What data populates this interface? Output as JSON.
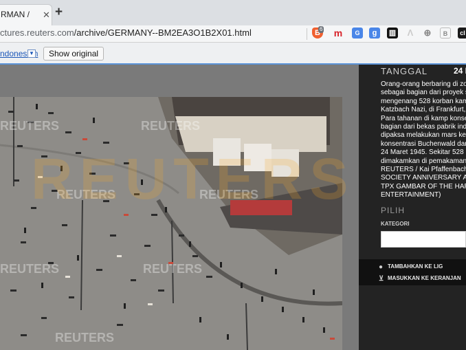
{
  "browser": {
    "tab_title": "RMAN /",
    "tab_close": "✕",
    "new_tab": "+",
    "url_host": "ctures.reuters.com",
    "url_path": "/archive/GERMANY--BM2EA3O1B2X01.html",
    "extensions": {
      "brave_badge": "6",
      "m": "m",
      "translate": "G",
      "google": "g",
      "bank": "▥",
      "a": "Λ",
      "globe": "⊕",
      "b": "B",
      "cl": "cl"
    }
  },
  "translate_bar": {
    "language": "ndonesian",
    "dropdown": "▼",
    "show_original": "Show original"
  },
  "photo": {
    "watermarks": [
      "REUTERS",
      "REUTERS",
      "REUTERS",
      "REUTERS",
      "REUTERS",
      "REUTERS",
      "REUTERS"
    ],
    "big_watermark": "REUTERS"
  },
  "sidebar": {
    "date_label": "TANGGAL",
    "date_value": "24 M",
    "caption": "Orang-orang berbaring di zon\nsebagai bagian dari proyek s\nmengenang 528 korban kam\nKatzbach Nazi, di Frankfurt, J\nPara tahanan di kamp konse\nbagian dari bekas pabrik indu\ndipaksa melakukan mars ker\nkonsentrasi Buchenwald dan\n24 Maret 1945. Sekitar 528 k\ndimakamkan di pemakaman\nREUTERS / Kai Pfaffenbach\nSOCIETY ANNIVERSARY A\nTPX GAMBAR OF THE HAR\nENTERTAINMENT)",
    "choose_label": "PILIH",
    "category_label": "KATEGORI",
    "add_to_lightbox": "TAMBAHKAN KE LIG",
    "add_to_cart": "MASUKKAN KE KERANJAN"
  },
  "colors": {
    "tab_strip": "#dcdfe3",
    "translate_accent": "#5b93d8",
    "sidebar_bg": "#232323",
    "brave_orange": "#f06030"
  }
}
